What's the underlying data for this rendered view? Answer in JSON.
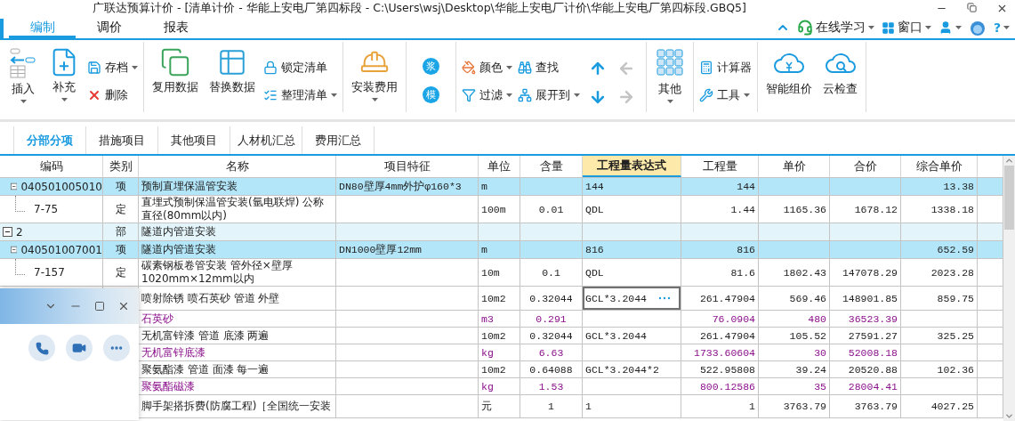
{
  "window": {
    "title": "广联达预算计价 - [清单计价 - 华能上安电厂第四标段 - C:\\Users\\wsj\\Desktop\\华能上安电厂计价\\华能上安电厂第四标段.GBQ5]"
  },
  "menu": {
    "tabs": [
      {
        "label": "编制",
        "selected": true
      },
      {
        "label": "调价",
        "selected": false
      },
      {
        "label": "报表",
        "selected": false
      }
    ],
    "right_items": [
      {
        "kind": "collapse"
      },
      {
        "kind": "link",
        "label": "在线学习",
        "dropdown": true
      },
      {
        "kind": "window",
        "label": "窗口",
        "dropdown": true
      },
      {
        "kind": "user",
        "dropdown": true
      },
      {
        "kind": "mascot"
      },
      {
        "kind": "help",
        "label": "?",
        "dropdown": true
      }
    ]
  },
  "ribbon": {
    "groups": [
      {
        "items": [
          {
            "kind": "large",
            "label": "插入",
            "dropdown": true
          },
          {
            "kind": "large",
            "label": "补充",
            "dropdown": true
          },
          {
            "kind": "stack",
            "items": [
              {
                "label": "存档",
                "dropdown": true
              },
              {
                "label": "删除",
                "dropdown": false
              }
            ]
          }
        ]
      },
      {
        "items": [
          {
            "kind": "large",
            "label": "复用数据",
            "dropdown": false
          },
          {
            "kind": "large",
            "label": "替换数据",
            "dropdown": false
          },
          {
            "kind": "stack",
            "items": [
              {
                "label": "锁定清单",
                "dropdown": false
              },
              {
                "label": "整理清单",
                "dropdown": true
              }
            ]
          }
        ]
      },
      {
        "items": [
          {
            "kind": "large",
            "label": "安装费用",
            "dropdown": true
          }
        ]
      },
      {
        "items": [
          {
            "kind": "badges",
            "labels": [
              "浆",
              "模"
            ]
          }
        ]
      },
      {
        "items": [
          {
            "kind": "stack",
            "items": [
              {
                "label": "颜色",
                "dropdown": true
              },
              {
                "label": "过滤",
                "dropdown": true
              }
            ]
          },
          {
            "kind": "stack",
            "items": [
              {
                "label": "查找",
                "dropdown": false
              },
              {
                "label": "展开到",
                "dropdown": true
              }
            ]
          },
          {
            "kind": "arrows",
            "arrows": [
              {
                "disabled": false
              },
              {
                "disabled": true
              },
              {
                "disabled": false
              },
              {
                "disabled": true
              }
            ]
          }
        ]
      },
      {
        "items": [
          {
            "kind": "large",
            "label": "其他",
            "dropdown": true
          }
        ]
      },
      {
        "items": [
          {
            "kind": "stack",
            "items": [
              {
                "label": "计算器",
                "dropdown": false
              },
              {
                "label": "工具",
                "dropdown": true
              }
            ]
          }
        ]
      },
      {
        "items": [
          {
            "kind": "large",
            "label": "智能组价",
            "dropdown": false
          },
          {
            "kind": "large",
            "label": "云检查",
            "dropdown": false
          }
        ]
      }
    ]
  },
  "subtabs": [
    {
      "label": "分部分项",
      "selected": true
    },
    {
      "label": "措施项目",
      "selected": false
    },
    {
      "label": "其他项目",
      "selected": false
    },
    {
      "label": "人材机汇总",
      "selected": false
    },
    {
      "label": "费用汇总",
      "selected": false
    }
  ],
  "table": {
    "columns": [
      {
        "label": "编码",
        "selected": false
      },
      {
        "label": "类别",
        "selected": false
      },
      {
        "label": "名称",
        "selected": false
      },
      {
        "label": "项目特征",
        "selected": false
      },
      {
        "label": "单位",
        "selected": false
      },
      {
        "label": "含量",
        "selected": false
      },
      {
        "label": "工程量表达式",
        "selected": true
      },
      {
        "label": "工程量",
        "selected": false
      },
      {
        "label": "单价",
        "selected": false
      },
      {
        "label": "合价",
        "selected": false
      },
      {
        "label": "综合单价",
        "selected": false
      }
    ],
    "rows": [
      {
        "kind": "item",
        "code": "040501005010",
        "type": "项",
        "name": "预制直埋保温管安装",
        "feature": "DN80壁厚4mm外护φ160*3",
        "unit": "m",
        "expr": "144",
        "qty": "144",
        "unit_price": "13.38",
        "expanded": true,
        "children": [
          {
            "kind": "quota",
            "code": "7-75",
            "type": "定",
            "name": "直埋式预制保温管安装(氩电联焊) 公称直径(80mm以内)",
            "unit": "100m",
            "content": "0.01",
            "expr": "QDL",
            "qty": "1.44",
            "price": "1165.36",
            "total": "1678.12",
            "unit_price": "1338.18"
          }
        ]
      },
      {
        "kind": "section",
        "code": "2",
        "type": "部",
        "name": "隧道内管道安装",
        "expanded": true,
        "children": [
          {
            "kind": "item",
            "code": "040501007001",
            "type": "项",
            "name": "隧道内管道安装",
            "feature": "DN1000壁厚12mm",
            "unit": "m",
            "expr": "816",
            "qty": "816",
            "unit_price": "652.59",
            "expanded": true,
            "children": [
              {
                "kind": "quota",
                "code": "7-157",
                "type": "定",
                "name": "碳素钢板卷管安装 管外径×壁厚1020mm×12mm以内",
                "unit": "10m",
                "content": "0.1",
                "expr": "QDL",
                "qty": "81.6",
                "price": "1802.43",
                "total": "147078.29",
                "unit_price": "2023.28"
              },
              {
                "kind": "quota",
                "name": "喷射除锈 喷石英砂 管道 外壁",
                "unit": "10m2",
                "content": "0.32044",
                "expr": "GCL*3.2044",
                "qty": "261.47904",
                "price": "569.46",
                "total": "148901.85",
                "unit_price": "859.75",
                "focused": true,
                "children": [
                  {
                    "kind": "material",
                    "name": "石英砂",
                    "unit": "m3",
                    "content": "0.291",
                    "qty": "76.0904",
                    "price": "480",
                    "total": "36523.39"
                  }
                ]
              },
              {
                "kind": "quota",
                "name": "无机富锌漆 管道 底漆 两遍",
                "unit": "10m2",
                "content": "0.32044",
                "expr": "GCL*3.2044",
                "qty": "261.47904",
                "price": "105.52",
                "total": "27591.27",
                "unit_price": "325.25",
                "focused": false,
                "children": [
                  {
                    "kind": "material",
                    "name": "无机富锌底漆",
                    "unit": "kg",
                    "content": "6.63",
                    "qty": "1733.60604",
                    "price": "30",
                    "total": "52008.18"
                  }
                ]
              },
              {
                "kind": "quota",
                "name": "聚氨酯漆 管道 面漆 每一遍",
                "unit": "10m2",
                "content": "0.64088",
                "expr": "GCL*3.2044*2",
                "qty": "522.95808",
                "price": "39.24",
                "total": "20520.88",
                "unit_price": "102.36",
                "focused": false,
                "children": [
                  {
                    "kind": "material",
                    "name": "聚氨酯磁漆",
                    "unit": "kg",
                    "content": "1.53",
                    "qty": "800.12586",
                    "price": "35",
                    "total": "28004.41"
                  }
                ]
              },
              {
                "kind": "quota",
                "name": "脚手架搭拆费(防腐工程)［全国统一安装",
                "unit": "元",
                "content": "1",
                "expr": "1",
                "qty": "1",
                "price": "3763.79",
                "total": "3763.79",
                "unit_price": "4027.25",
                "focused": false
              }
            ]
          }
        ]
      }
    ]
  }
}
